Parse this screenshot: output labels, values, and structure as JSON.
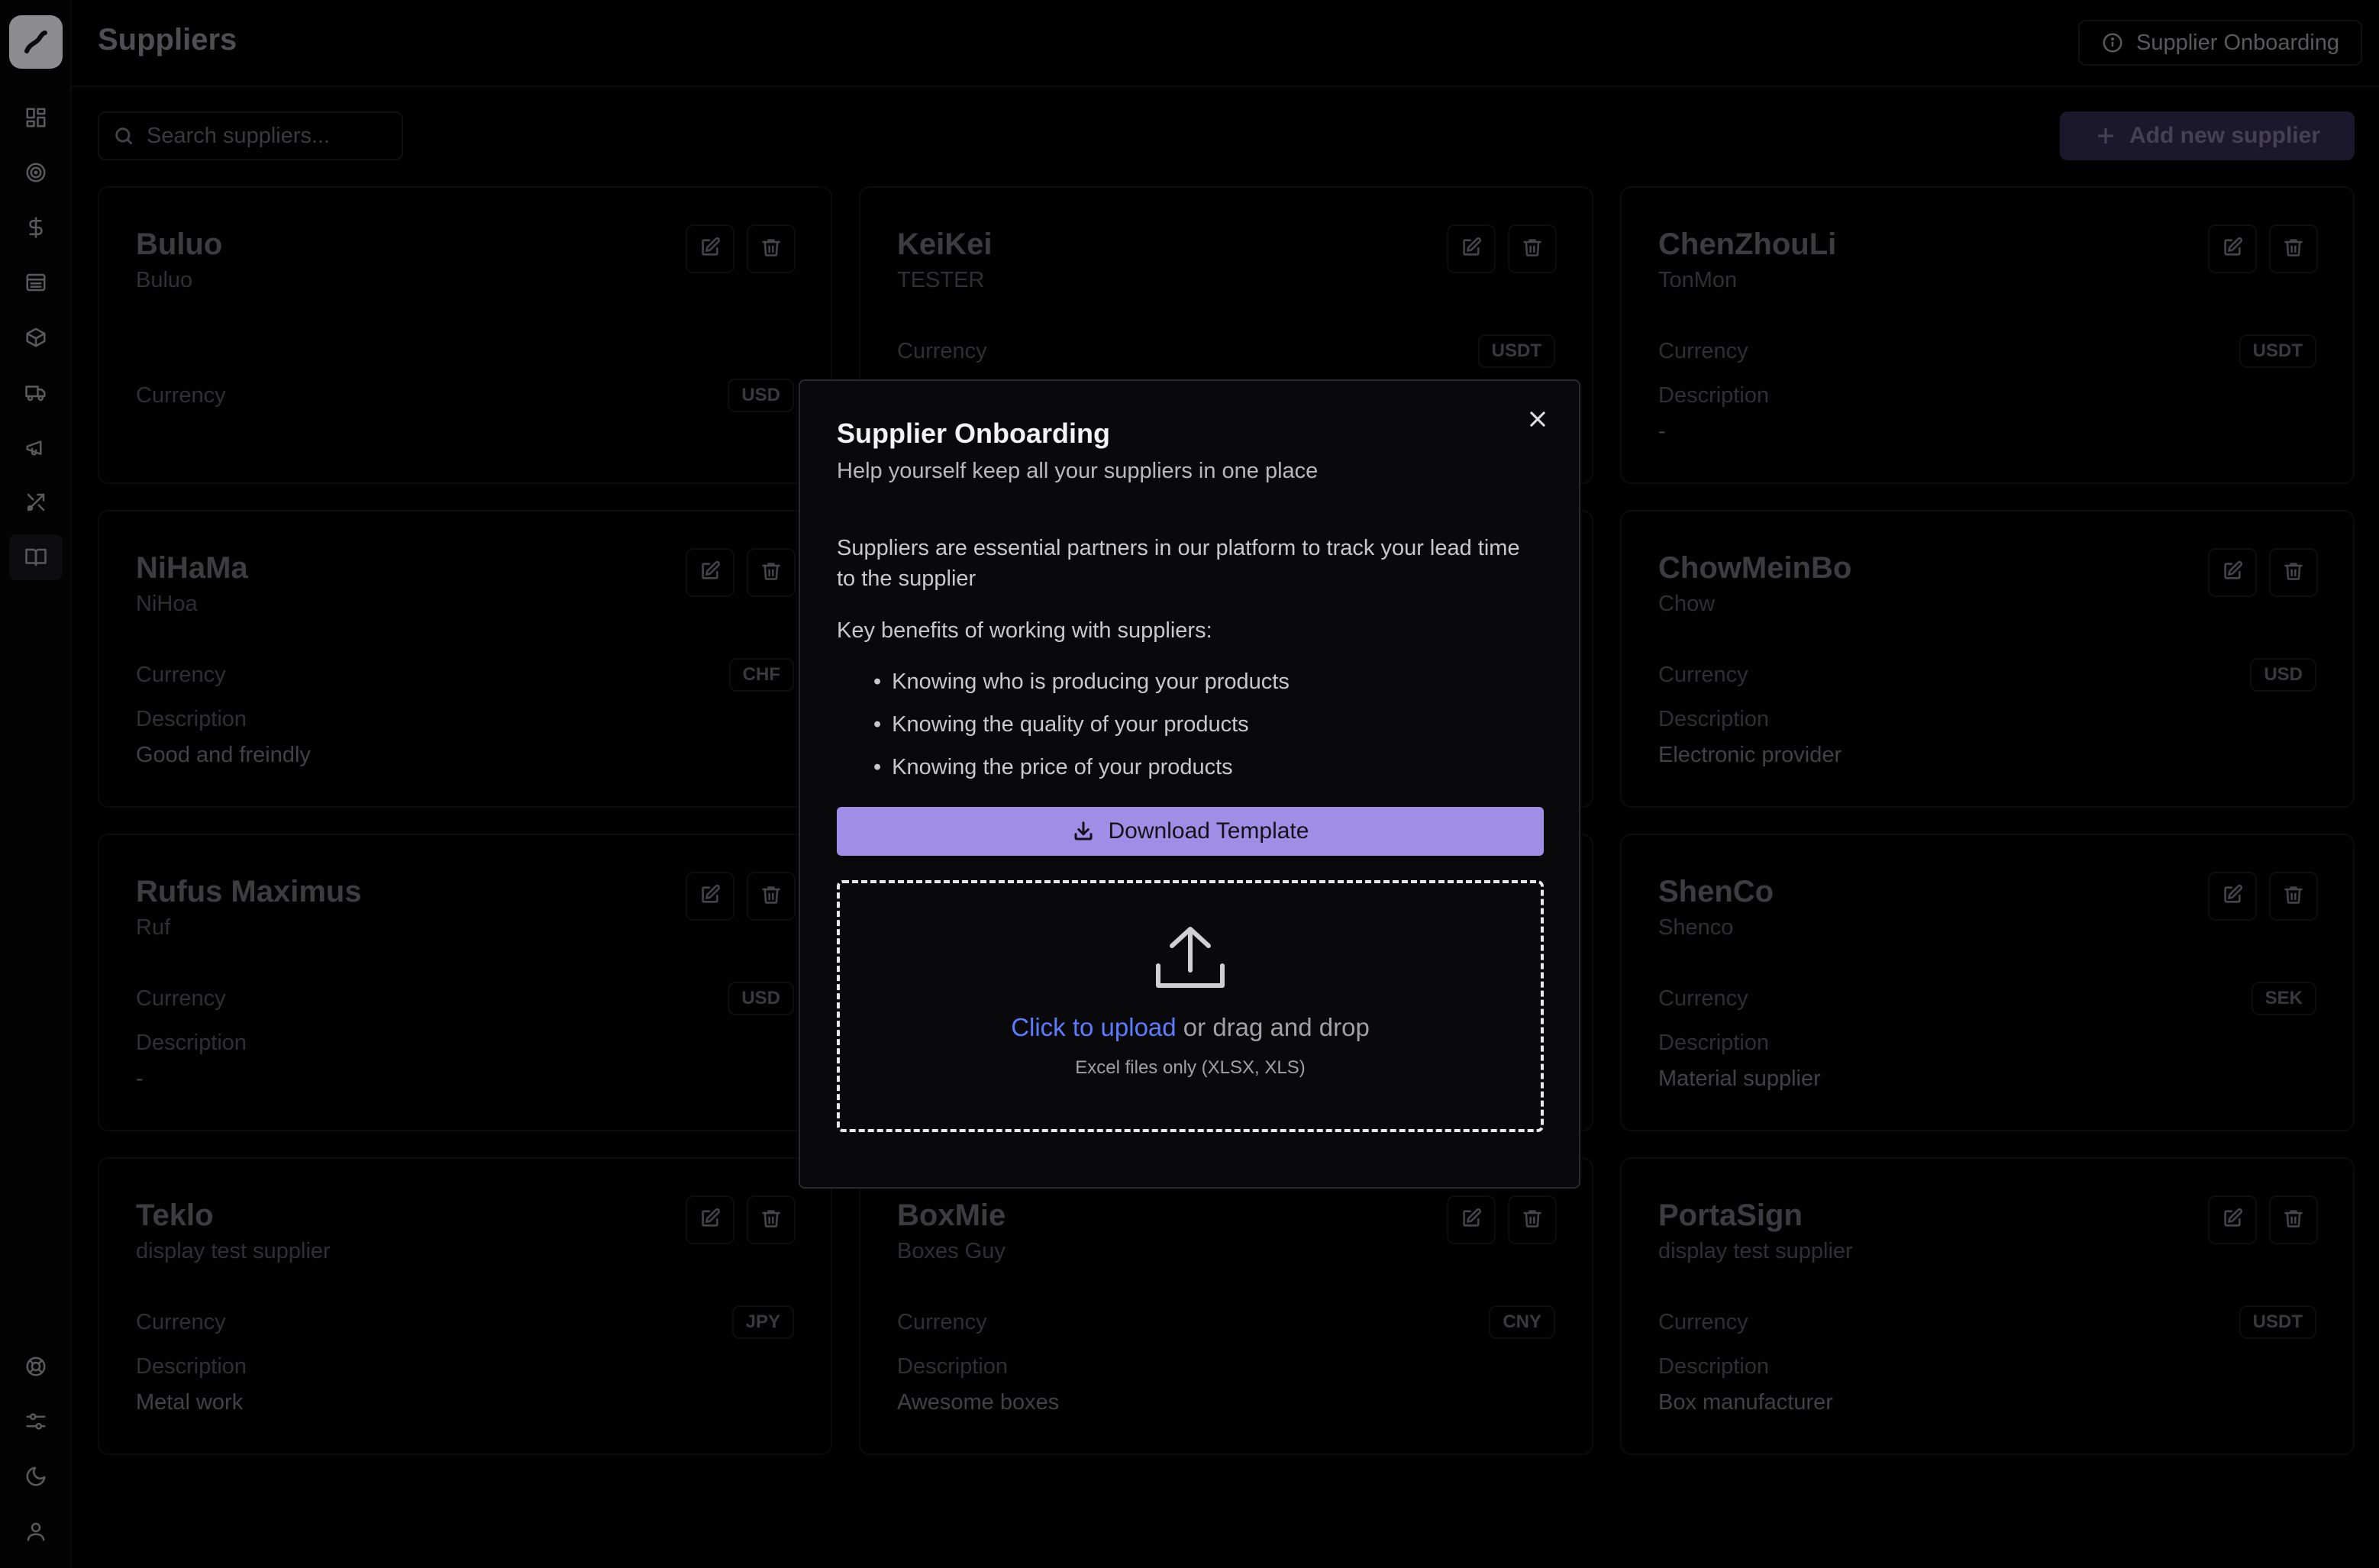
{
  "header": {
    "title": "Suppliers",
    "onboarding_label": "Supplier Onboarding"
  },
  "toolbar": {
    "search_placeholder": "Search suppliers...",
    "add_label": "Add new supplier"
  },
  "sidebar": {
    "icons": [
      "dashboard-icon",
      "target-icon",
      "dollar-icon",
      "archive-icon",
      "box-icon",
      "truck-icon",
      "megaphone-icon",
      "tools-icon",
      "book-icon"
    ],
    "active": "book-icon",
    "bottom_icons": [
      "help-icon",
      "sliders-icon",
      "moon-icon",
      "user-icon"
    ]
  },
  "labels": {
    "currency": "Currency",
    "description": "Description"
  },
  "suppliers": [
    {
      "name": "Buluo",
      "sub": "Buluo",
      "currency": "USD",
      "description": null
    },
    {
      "name": "KeiKei",
      "sub": "TESTER",
      "currency": "USDT",
      "description": null
    },
    {
      "name": "ChenZhouLi",
      "sub": "TonMon",
      "currency": "USDT",
      "description": "-"
    },
    {
      "name": "NiHaMa",
      "sub": "NiHoa",
      "currency": "CHF",
      "description": "Good and freindly"
    },
    {
      "name": "",
      "sub": "",
      "currency": "",
      "description": null
    },
    {
      "name": "ChowMeinBo",
      "sub": "Chow",
      "currency": "USD",
      "description": "Electronic provider"
    },
    {
      "name": "Rufus Maximus",
      "sub": "Ruf",
      "currency": "USD",
      "description": "-"
    },
    {
      "name": "",
      "sub": "",
      "currency": "",
      "description": null
    },
    {
      "name": "ShenCo",
      "sub": "Shenco",
      "currency": "SEK",
      "description": "Material supplier"
    },
    {
      "name": "Teklo",
      "sub": "display test supplier",
      "currency": "JPY",
      "description": "Metal work"
    },
    {
      "name": "BoxMie",
      "sub": "Boxes Guy",
      "currency": "CNY",
      "description": "Awesome boxes"
    },
    {
      "name": "PortaSign",
      "sub": "display test supplier",
      "currency": "USDT",
      "description": "Box manufacturer"
    }
  ],
  "modal": {
    "title": "Supplier Onboarding",
    "subtitle": "Help yourself keep all your suppliers in one place",
    "intro": "Suppliers are essential partners in our platform to track your lead time to the supplier",
    "benefits_title": "Key benefits of working with suppliers:",
    "benefits": [
      "Knowing who is producing your products",
      "Knowing the quality of your products",
      "Knowing the price of your products"
    ],
    "download_label": "Download Template",
    "upload_link": "Click to upload",
    "upload_rest": " or drag and drop",
    "upload_hint": "Excel files only (XLSX, XLS)"
  }
}
